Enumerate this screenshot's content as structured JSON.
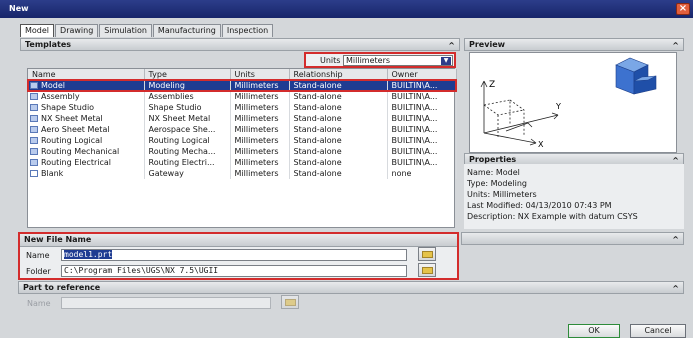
{
  "window": {
    "title": "New",
    "close_glyph": "×"
  },
  "tabs": [
    "Model",
    "Drawing",
    "Simulation",
    "Manufacturing",
    "Inspection"
  ],
  "templates": {
    "header": "Templates",
    "units_label": "Units",
    "units_value": "Millimeters",
    "columns": [
      "Name",
      "Type",
      "Units",
      "Relationship",
      "Owner"
    ],
    "rows": [
      [
        "Model",
        "Modeling",
        "Millimeters",
        "Stand-alone",
        "BUILTIN\\A..."
      ],
      [
        "Assembly",
        "Assemblies",
        "Millimeters",
        "Stand-alone",
        "BUILTIN\\A..."
      ],
      [
        "Shape Studio",
        "Shape Studio",
        "Millimeters",
        "Stand-alone",
        "BUILTIN\\A..."
      ],
      [
        "NX Sheet Metal",
        "NX Sheet Metal",
        "Millimeters",
        "Stand-alone",
        "BUILTIN\\A..."
      ],
      [
        "Aero Sheet Metal",
        "Aerospace She...",
        "Millimeters",
        "Stand-alone",
        "BUILTIN\\A..."
      ],
      [
        "Routing Logical",
        "Routing Logical",
        "Millimeters",
        "Stand-alone",
        "BUILTIN\\A..."
      ],
      [
        "Routing Mechanical",
        "Routing Mecha...",
        "Millimeters",
        "Stand-alone",
        "BUILTIN\\A..."
      ],
      [
        "Routing Electrical",
        "Routing Electri...",
        "Millimeters",
        "Stand-alone",
        "BUILTIN\\A..."
      ],
      [
        "Blank",
        "Gateway",
        "Millimeters",
        "Stand-alone",
        "none"
      ]
    ]
  },
  "preview": {
    "header": "Preview",
    "axis_z": "Z",
    "axis_y": "Y",
    "axis_x": "X"
  },
  "properties": {
    "header": "Properties",
    "name": "Name: Model",
    "type": "Type: Modeling",
    "units": "Units: Millimeters",
    "modified": "Last Modified: 04/13/2010 07:43 PM",
    "description": "Description: NX Example with datum CSYS"
  },
  "new_file": {
    "header": "New File Name",
    "name_label": "Name",
    "name_value": "model1.prt",
    "folder_label": "Folder",
    "folder_value": "C:\\Program Files\\UGS\\NX 7.5\\UGII"
  },
  "part_ref": {
    "header": "Part to reference",
    "name_label": "Name"
  },
  "buttons": {
    "ok": "OK",
    "cancel": "Cancel"
  },
  "colors": {
    "title_bar": "#17256a",
    "highlight": "#d32c2c",
    "selection": "#1f3c92"
  }
}
